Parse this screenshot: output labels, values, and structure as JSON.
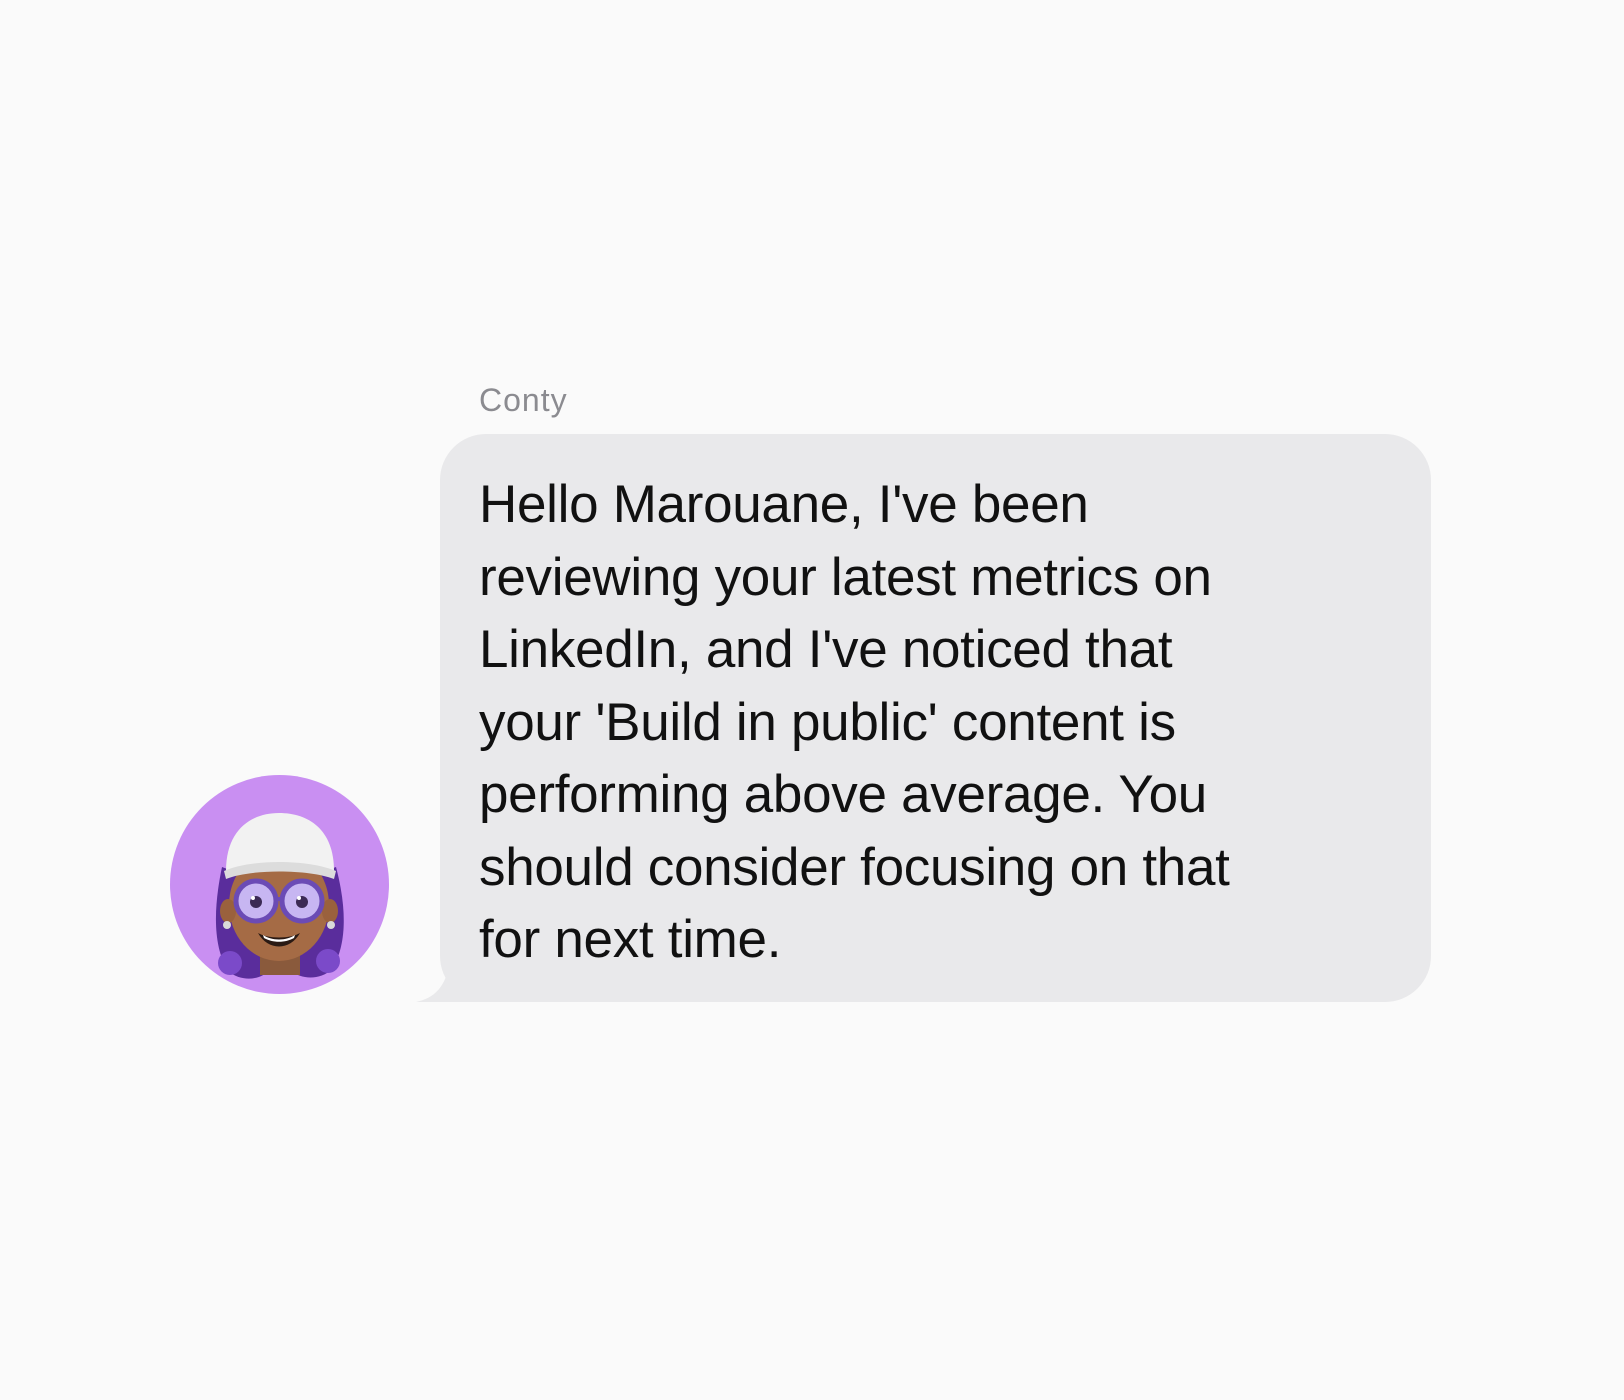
{
  "conversation": {
    "sender_name": "Conty",
    "message": {
      "text": "Hello Marouane, I've been\nreviewing your latest metrics on\nLinkedIn, and I've noticed that\nyour 'Build in public' content is\nperforming above average. You\nshould consider focusing on that\nfor next time.",
      "direction": "incoming"
    },
    "avatar": {
      "icon": "memoji-avatar-icon",
      "background_color": "#c98ff2"
    }
  },
  "colors": {
    "page_background": "#fafafa",
    "bubble_background": "#e9e9eb",
    "sender_name": "#8b8b90",
    "message_text": "#111111"
  }
}
